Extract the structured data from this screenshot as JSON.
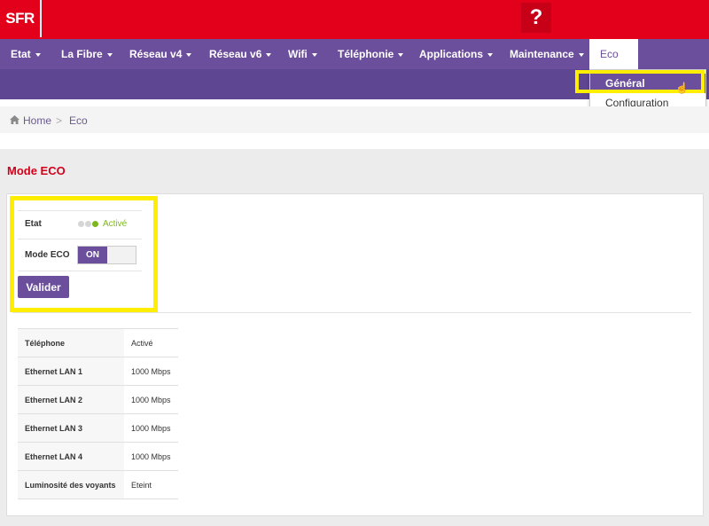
{
  "header": {
    "logo": "SFR",
    "help_label": "?"
  },
  "nav": {
    "items": [
      {
        "label": "Etat",
        "has_caret": true
      },
      {
        "label": "La Fibre",
        "has_caret": true
      },
      {
        "label": "Réseau v4",
        "has_caret": true
      },
      {
        "label": "Réseau v6",
        "has_caret": true
      },
      {
        "label": "Wifi",
        "has_caret": true
      },
      {
        "label": "Téléphonie",
        "has_caret": true
      },
      {
        "label": "Applications",
        "has_caret": true
      },
      {
        "label": "Maintenance",
        "has_caret": true
      },
      {
        "label": "Eco",
        "has_caret": false,
        "active": true
      }
    ],
    "dropdown": [
      "Général",
      "Configuration"
    ]
  },
  "breadcrumb": {
    "home": "Home",
    "separator": ">",
    "current": "Eco"
  },
  "page_title": "Mode ECO",
  "eco_form": {
    "etat_label": "Etat",
    "etat_value": "Activé",
    "mode_label": "Mode ECO",
    "mode_toggle": "ON",
    "submit_label": "Valider"
  },
  "info_table": [
    {
      "label": "Téléphone",
      "value": "Activé"
    },
    {
      "label": "Ethernet LAN 1",
      "value": "1000 Mbps"
    },
    {
      "label": "Ethernet LAN 2",
      "value": "1000 Mbps"
    },
    {
      "label": "Ethernet LAN 3",
      "value": "1000 Mbps"
    },
    {
      "label": "Ethernet LAN 4",
      "value": "1000 Mbps"
    },
    {
      "label": "Luminosité des voyants",
      "value": "Eteint"
    }
  ],
  "colors": {
    "brand_red": "#e2001a",
    "accent_purple": "#6b4e9c",
    "highlight_yellow": "#ffee00",
    "status_green": "#7cb81c"
  }
}
